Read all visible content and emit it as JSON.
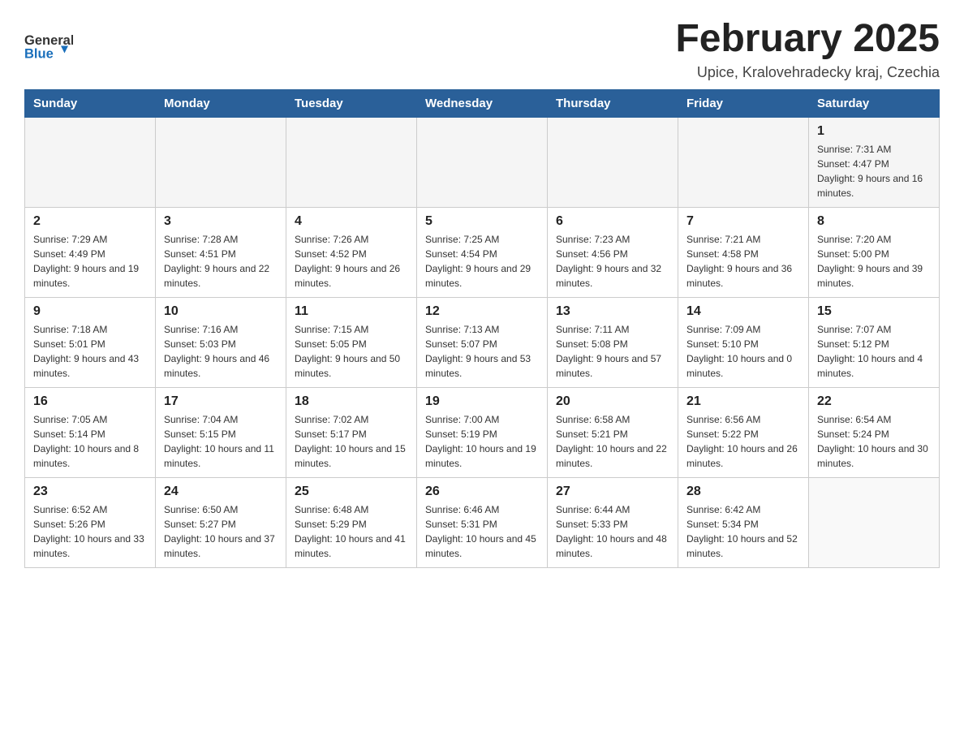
{
  "header": {
    "title": "February 2025",
    "subtitle": "Upice, Kralovehradecky kraj, Czechia",
    "logo_general": "General",
    "logo_blue": "Blue"
  },
  "days_of_week": [
    "Sunday",
    "Monday",
    "Tuesday",
    "Wednesday",
    "Thursday",
    "Friday",
    "Saturday"
  ],
  "weeks": [
    [
      {
        "day": "",
        "sunrise": "",
        "sunset": "",
        "daylight": "",
        "empty": true
      },
      {
        "day": "",
        "sunrise": "",
        "sunset": "",
        "daylight": "",
        "empty": true
      },
      {
        "day": "",
        "sunrise": "",
        "sunset": "",
        "daylight": "",
        "empty": true
      },
      {
        "day": "",
        "sunrise": "",
        "sunset": "",
        "daylight": "",
        "empty": true
      },
      {
        "day": "",
        "sunrise": "",
        "sunset": "",
        "daylight": "",
        "empty": true
      },
      {
        "day": "",
        "sunrise": "",
        "sunset": "",
        "daylight": "",
        "empty": true
      },
      {
        "day": "1",
        "sunrise": "Sunrise: 7:31 AM",
        "sunset": "Sunset: 4:47 PM",
        "daylight": "Daylight: 9 hours and 16 minutes.",
        "empty": false
      }
    ],
    [
      {
        "day": "2",
        "sunrise": "Sunrise: 7:29 AM",
        "sunset": "Sunset: 4:49 PM",
        "daylight": "Daylight: 9 hours and 19 minutes.",
        "empty": false
      },
      {
        "day": "3",
        "sunrise": "Sunrise: 7:28 AM",
        "sunset": "Sunset: 4:51 PM",
        "daylight": "Daylight: 9 hours and 22 minutes.",
        "empty": false
      },
      {
        "day": "4",
        "sunrise": "Sunrise: 7:26 AM",
        "sunset": "Sunset: 4:52 PM",
        "daylight": "Daylight: 9 hours and 26 minutes.",
        "empty": false
      },
      {
        "day": "5",
        "sunrise": "Sunrise: 7:25 AM",
        "sunset": "Sunset: 4:54 PM",
        "daylight": "Daylight: 9 hours and 29 minutes.",
        "empty": false
      },
      {
        "day": "6",
        "sunrise": "Sunrise: 7:23 AM",
        "sunset": "Sunset: 4:56 PM",
        "daylight": "Daylight: 9 hours and 32 minutes.",
        "empty": false
      },
      {
        "day": "7",
        "sunrise": "Sunrise: 7:21 AM",
        "sunset": "Sunset: 4:58 PM",
        "daylight": "Daylight: 9 hours and 36 minutes.",
        "empty": false
      },
      {
        "day": "8",
        "sunrise": "Sunrise: 7:20 AM",
        "sunset": "Sunset: 5:00 PM",
        "daylight": "Daylight: 9 hours and 39 minutes.",
        "empty": false
      }
    ],
    [
      {
        "day": "9",
        "sunrise": "Sunrise: 7:18 AM",
        "sunset": "Sunset: 5:01 PM",
        "daylight": "Daylight: 9 hours and 43 minutes.",
        "empty": false
      },
      {
        "day": "10",
        "sunrise": "Sunrise: 7:16 AM",
        "sunset": "Sunset: 5:03 PM",
        "daylight": "Daylight: 9 hours and 46 minutes.",
        "empty": false
      },
      {
        "day": "11",
        "sunrise": "Sunrise: 7:15 AM",
        "sunset": "Sunset: 5:05 PM",
        "daylight": "Daylight: 9 hours and 50 minutes.",
        "empty": false
      },
      {
        "day": "12",
        "sunrise": "Sunrise: 7:13 AM",
        "sunset": "Sunset: 5:07 PM",
        "daylight": "Daylight: 9 hours and 53 minutes.",
        "empty": false
      },
      {
        "day": "13",
        "sunrise": "Sunrise: 7:11 AM",
        "sunset": "Sunset: 5:08 PM",
        "daylight": "Daylight: 9 hours and 57 minutes.",
        "empty": false
      },
      {
        "day": "14",
        "sunrise": "Sunrise: 7:09 AM",
        "sunset": "Sunset: 5:10 PM",
        "daylight": "Daylight: 10 hours and 0 minutes.",
        "empty": false
      },
      {
        "day": "15",
        "sunrise": "Sunrise: 7:07 AM",
        "sunset": "Sunset: 5:12 PM",
        "daylight": "Daylight: 10 hours and 4 minutes.",
        "empty": false
      }
    ],
    [
      {
        "day": "16",
        "sunrise": "Sunrise: 7:05 AM",
        "sunset": "Sunset: 5:14 PM",
        "daylight": "Daylight: 10 hours and 8 minutes.",
        "empty": false
      },
      {
        "day": "17",
        "sunrise": "Sunrise: 7:04 AM",
        "sunset": "Sunset: 5:15 PM",
        "daylight": "Daylight: 10 hours and 11 minutes.",
        "empty": false
      },
      {
        "day": "18",
        "sunrise": "Sunrise: 7:02 AM",
        "sunset": "Sunset: 5:17 PM",
        "daylight": "Daylight: 10 hours and 15 minutes.",
        "empty": false
      },
      {
        "day": "19",
        "sunrise": "Sunrise: 7:00 AM",
        "sunset": "Sunset: 5:19 PM",
        "daylight": "Daylight: 10 hours and 19 minutes.",
        "empty": false
      },
      {
        "day": "20",
        "sunrise": "Sunrise: 6:58 AM",
        "sunset": "Sunset: 5:21 PM",
        "daylight": "Daylight: 10 hours and 22 minutes.",
        "empty": false
      },
      {
        "day": "21",
        "sunrise": "Sunrise: 6:56 AM",
        "sunset": "Sunset: 5:22 PM",
        "daylight": "Daylight: 10 hours and 26 minutes.",
        "empty": false
      },
      {
        "day": "22",
        "sunrise": "Sunrise: 6:54 AM",
        "sunset": "Sunset: 5:24 PM",
        "daylight": "Daylight: 10 hours and 30 minutes.",
        "empty": false
      }
    ],
    [
      {
        "day": "23",
        "sunrise": "Sunrise: 6:52 AM",
        "sunset": "Sunset: 5:26 PM",
        "daylight": "Daylight: 10 hours and 33 minutes.",
        "empty": false
      },
      {
        "day": "24",
        "sunrise": "Sunrise: 6:50 AM",
        "sunset": "Sunset: 5:27 PM",
        "daylight": "Daylight: 10 hours and 37 minutes.",
        "empty": false
      },
      {
        "day": "25",
        "sunrise": "Sunrise: 6:48 AM",
        "sunset": "Sunset: 5:29 PM",
        "daylight": "Daylight: 10 hours and 41 minutes.",
        "empty": false
      },
      {
        "day": "26",
        "sunrise": "Sunrise: 6:46 AM",
        "sunset": "Sunset: 5:31 PM",
        "daylight": "Daylight: 10 hours and 45 minutes.",
        "empty": false
      },
      {
        "day": "27",
        "sunrise": "Sunrise: 6:44 AM",
        "sunset": "Sunset: 5:33 PM",
        "daylight": "Daylight: 10 hours and 48 minutes.",
        "empty": false
      },
      {
        "day": "28",
        "sunrise": "Sunrise: 6:42 AM",
        "sunset": "Sunset: 5:34 PM",
        "daylight": "Daylight: 10 hours and 52 minutes.",
        "empty": false
      },
      {
        "day": "",
        "sunrise": "",
        "sunset": "",
        "daylight": "",
        "empty": true
      }
    ]
  ]
}
